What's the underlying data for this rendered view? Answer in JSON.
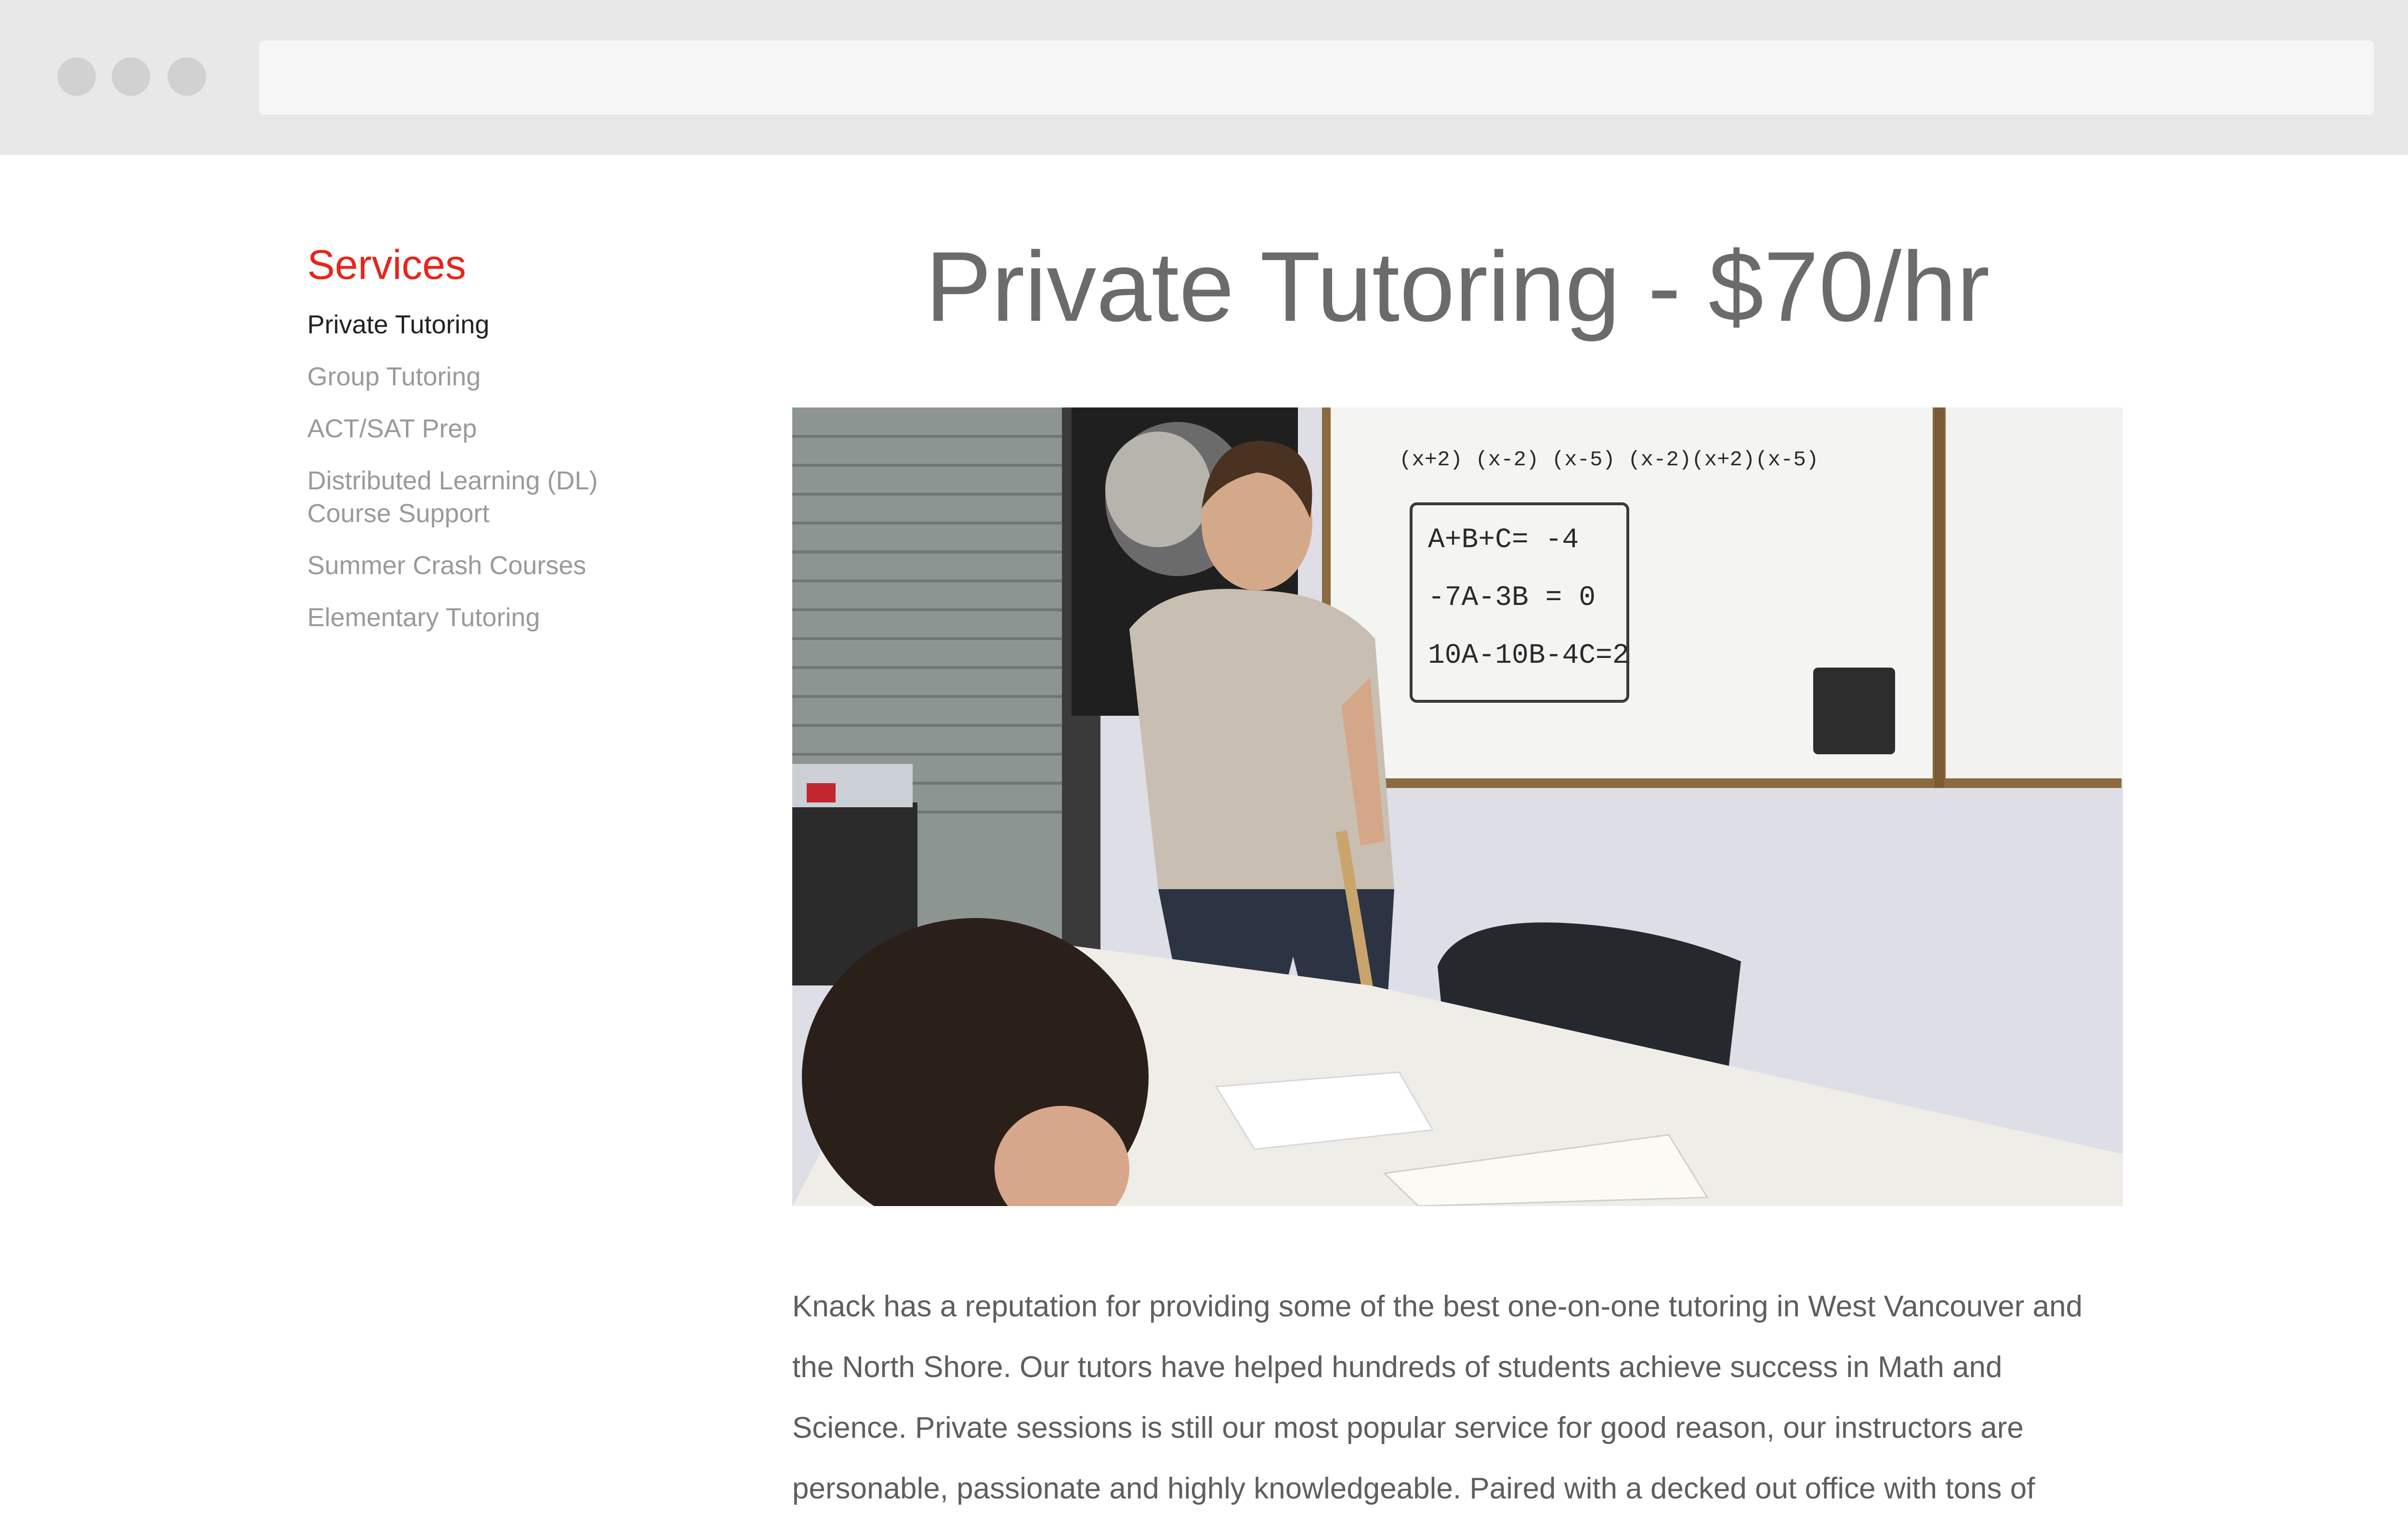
{
  "sidebar": {
    "title": "Services",
    "items": [
      {
        "label": "Private Tutoring",
        "active": true
      },
      {
        "label": "Group Tutoring",
        "active": false
      },
      {
        "label": "ACT/SAT Prep",
        "active": false
      },
      {
        "label": "Distributed Learning (DL)\nCourse Support",
        "active": false
      },
      {
        "label": "Summer Crash Courses",
        "active": false
      },
      {
        "label": "Elementary Tutoring",
        "active": false
      }
    ]
  },
  "main": {
    "title": "Private Tutoring - $70/hr",
    "hero_image": {
      "description": "photo-tutor-at-whiteboard",
      "whiteboard": {
        "line1": "A+B+C= -4",
        "line2": "-7A-3B = 0",
        "line3": "10A-10B-4C=2",
        "top": "(x+2)  (x-2)  (x-5)   (x-2)(x+2)(x-5)"
      }
    },
    "body": "Knack has a reputation for providing some of the best one-on-one tutoring in West Vancouver and the North Shore. Our tutors have helped hundreds of students achieve success in Math and Science. Private sessions is still our most popular service for good reason, our instructors are personable, passionate and highly knowledgeable. Paired with a decked out office with tons of"
  },
  "colors": {
    "accent": "#e8241b",
    "chrome": "#e8e8e8",
    "active_text": "#222222",
    "muted_text": "#9a9a9a"
  }
}
